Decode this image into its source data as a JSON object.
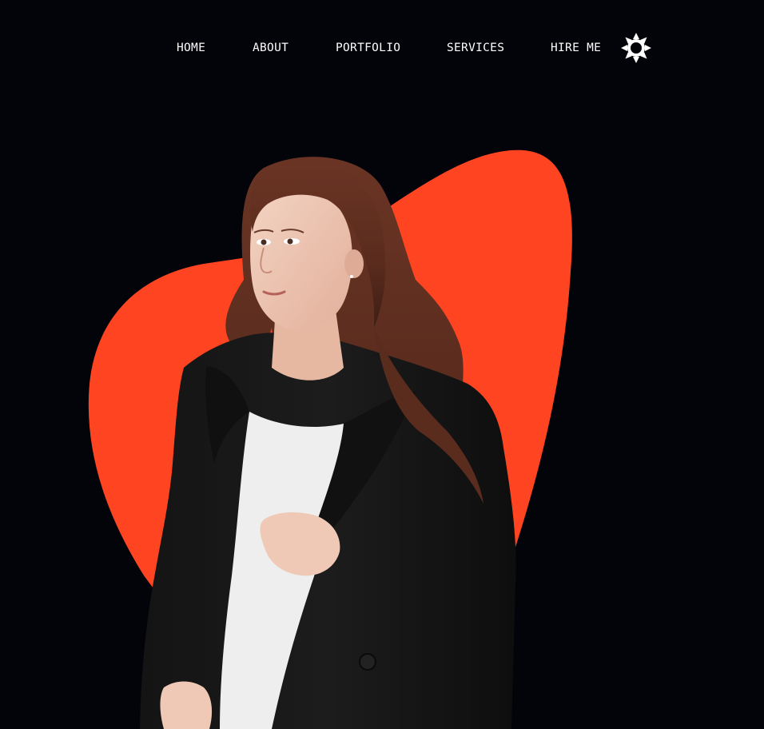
{
  "nav": {
    "items": [
      {
        "label": "HOME"
      },
      {
        "label": "ABOUT"
      },
      {
        "label": "PORTFOLIO"
      },
      {
        "label": "SERVICES"
      },
      {
        "label": "HIRE ME"
      }
    ],
    "theme_toggle_icon": "sun-icon"
  },
  "colors": {
    "background": "#03030a",
    "accent": "#ff4422",
    "text": "#ffffff"
  }
}
